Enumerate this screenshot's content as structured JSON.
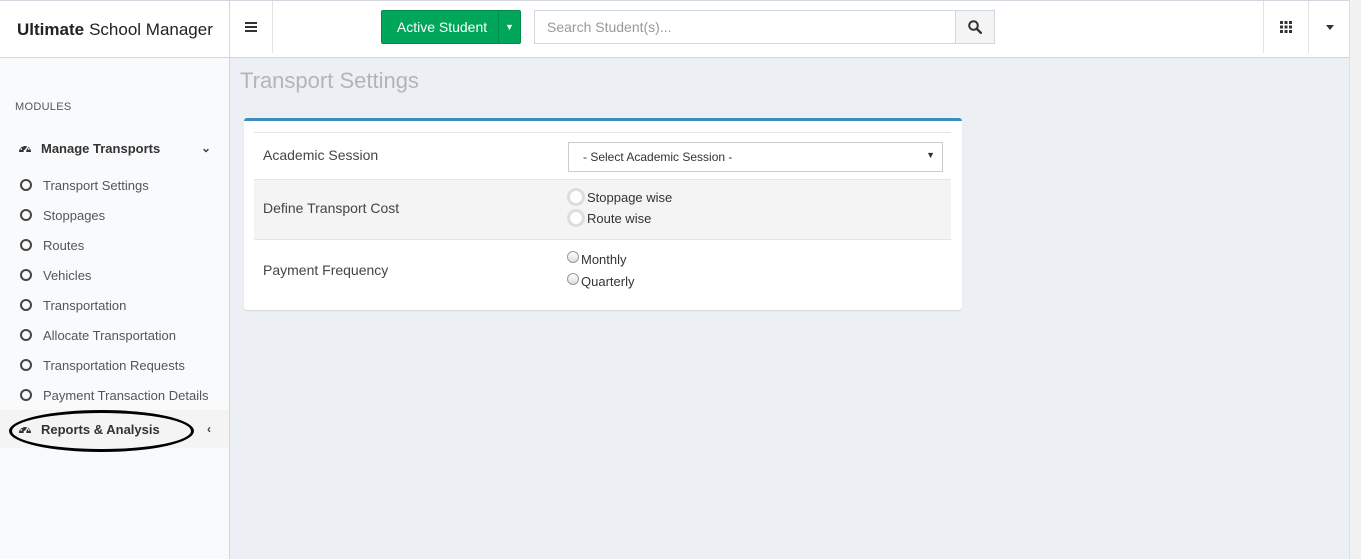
{
  "header": {
    "brand_bold": "Ultimate",
    "brand_rest": "School Manager",
    "active_student_label": "Active Student",
    "search_placeholder": "Search Student(s)..."
  },
  "sidebar": {
    "section_label": "MODULES",
    "group": {
      "label": "Manage Transports",
      "icon": "dashboard-icon"
    },
    "items": [
      {
        "label": "Transport Settings"
      },
      {
        "label": "Stoppages"
      },
      {
        "label": "Routes"
      },
      {
        "label": "Vehicles"
      },
      {
        "label": "Transportation"
      },
      {
        "label": "Allocate Transportation"
      },
      {
        "label": "Transportation Requests"
      },
      {
        "label": "Payment Transaction Details"
      }
    ],
    "reports": {
      "label": "Reports & Analysis",
      "icon": "dashboard-icon"
    }
  },
  "main": {
    "page_title": "Transport Settings",
    "form": {
      "academic_session_label": "Academic Session",
      "academic_session_value": "- Select Academic Session -",
      "transport_cost_label": "Define Transport Cost",
      "transport_cost_options": [
        "Stoppage wise",
        "Route wise"
      ],
      "payment_frequency_label": "Payment Frequency",
      "payment_frequency_options": [
        "Monthly",
        "Quarterly"
      ]
    }
  },
  "colors": {
    "accent_green": "#00a65a",
    "box_top_border": "#3c8dbc",
    "content_background": "#ecf0f5"
  }
}
